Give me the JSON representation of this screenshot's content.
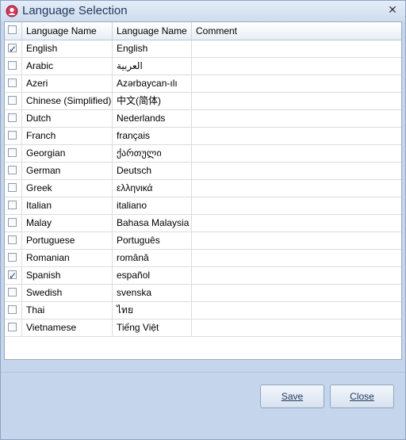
{
  "window": {
    "title": "Language Selection"
  },
  "grid": {
    "columns": [
      "Language Name",
      "Language Name",
      "Comment"
    ],
    "rows": [
      {
        "name": "English",
        "native": "English",
        "comment": "",
        "checked": true
      },
      {
        "name": "Arabic",
        "native": "العربية",
        "comment": "",
        "checked": false
      },
      {
        "name": "Azeri",
        "native": "Azərbaycan-ılı",
        "comment": "",
        "checked": false
      },
      {
        "name": "Chinese (Simplified)",
        "native": "中文(简体)",
        "comment": "",
        "checked": false
      },
      {
        "name": "Dutch",
        "native": "Nederlands",
        "comment": "",
        "checked": false
      },
      {
        "name": "Franch",
        "native": "français",
        "comment": "",
        "checked": false
      },
      {
        "name": "Georgian",
        "native": "ქართული",
        "comment": "",
        "checked": false
      },
      {
        "name": "German",
        "native": "Deutsch",
        "comment": "",
        "checked": false
      },
      {
        "name": "Greek",
        "native": "ελληνικά",
        "comment": "",
        "checked": false
      },
      {
        "name": "Italian",
        "native": "italiano",
        "comment": "",
        "checked": false
      },
      {
        "name": "Malay",
        "native": "Bahasa Malaysia",
        "comment": "",
        "checked": false
      },
      {
        "name": "Portuguese",
        "native": "Português",
        "comment": "",
        "checked": false
      },
      {
        "name": "Romanian",
        "native": "română",
        "comment": "",
        "checked": false
      },
      {
        "name": "Spanish",
        "native": "español",
        "comment": "",
        "checked": true
      },
      {
        "name": "Swedish",
        "native": "svenska",
        "comment": "",
        "checked": false
      },
      {
        "name": "Thai",
        "native": "ไทย",
        "comment": "",
        "checked": false
      },
      {
        "name": "Vietnamese",
        "native": "Tiếng Việt",
        "comment": "",
        "checked": false
      }
    ]
  },
  "buttons": {
    "save": "Save",
    "close": "Close"
  },
  "icons": {
    "app": "app-logo-icon",
    "close": "close-icon",
    "checkbox": "checkbox-icon"
  }
}
